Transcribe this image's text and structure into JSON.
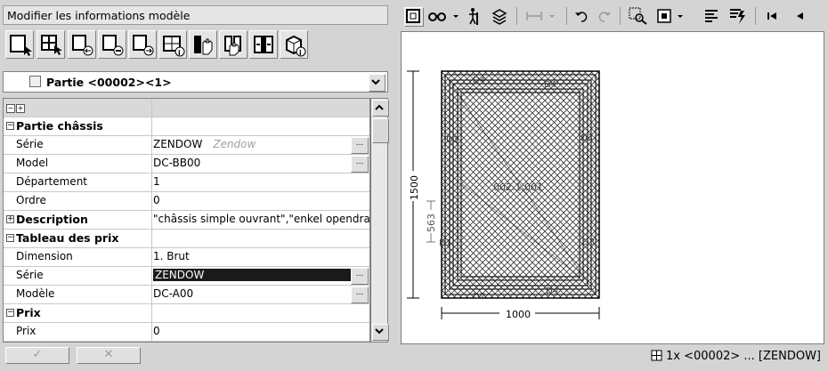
{
  "window_title": "Modifier les informations modèle",
  "toolbar_icons": [
    "select-part-icon",
    "select-grid-icon",
    "part-left-icon",
    "part-remove-icon",
    "part-right-icon",
    "grid-info-icon",
    "hand-cut-icon",
    "hand-split-icon",
    "insert-part-icon",
    "part-3d-info-icon"
  ],
  "selector": {
    "value": "Partie <00002><1>"
  },
  "grid": {
    "rows": [
      {
        "type": "group",
        "label": "Partie châssis",
        "sign": "−"
      },
      {
        "type": "prop",
        "label": "Série",
        "value": "ZENDOW",
        "hint": "Zendow",
        "ellipsis": true
      },
      {
        "type": "prop",
        "label": "Model",
        "value": "DC-BB00",
        "ellipsis": true
      },
      {
        "type": "prop",
        "label": "Département",
        "value": "1"
      },
      {
        "type": "prop",
        "label": "Ordre",
        "value": "0"
      },
      {
        "type": "group",
        "label": "Description",
        "sign": "+",
        "value": "\"châssis simple ouvrant\",\"enkel opendra"
      },
      {
        "type": "group",
        "label": "Tableau des prix",
        "sign": "−"
      },
      {
        "type": "prop",
        "label": "Dimension",
        "value": "1. Brut"
      },
      {
        "type": "prop",
        "label": "Série",
        "value": "ZENDOW",
        "highlight": true,
        "ellipsis": true
      },
      {
        "type": "prop",
        "label": "Modèle",
        "value": "DC-A00",
        "ellipsis": true
      },
      {
        "type": "group",
        "label": "Prix",
        "sign": "−"
      },
      {
        "type": "prop",
        "label": "Prix",
        "value": "0"
      }
    ]
  },
  "footer_buttons": {
    "ok": "✓",
    "cancel": "✕"
  },
  "drawing": {
    "width_label": "1000",
    "height_label": "1500",
    "sub_height_label": "563",
    "center_label": "002.1.001",
    "edge_labels": {
      "top": "D4",
      "top2": "D4",
      "left": "D1",
      "right": "D3",
      "bottom": "D2",
      "bottom2": "D4",
      "lower_left": "D1",
      "lower_right": "D3"
    }
  },
  "status": {
    "text": "1x <00002> ... [ZENDOW]"
  },
  "colors": {
    "panel": "#d4d4d4",
    "highlight": "#1a1a1a"
  }
}
